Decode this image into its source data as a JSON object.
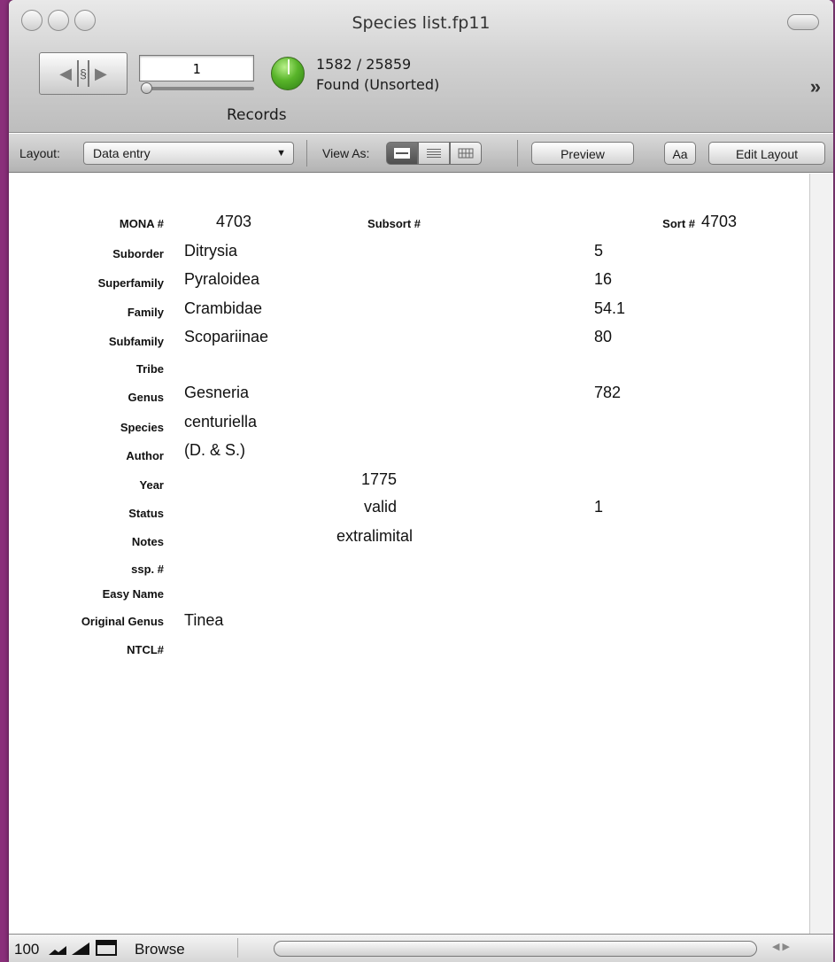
{
  "window": {
    "title": "Species list.fp11"
  },
  "status_toolbar": {
    "current_record": "1",
    "found_count": "1582 / 25859",
    "found_state": "Found (Unsorted)",
    "records_label": "Records",
    "more_chevron": "»"
  },
  "layout_bar": {
    "layout_label": "Layout:",
    "layout_selected": "Data entry",
    "view_as_label": "View As:",
    "preview_label": "Preview",
    "aa_label": "Aa",
    "edit_layout_label": "Edit Layout"
  },
  "record": {
    "mona_label": "MONA #",
    "mona_value": "4703",
    "subsort_label": "Subsort #",
    "sort_label": "Sort #",
    "sort_value": "4703",
    "rows": [
      {
        "label": "Suborder",
        "value": "Ditrysia",
        "num": "5"
      },
      {
        "label": "Superfamily",
        "value": "Pyraloidea",
        "num": "16"
      },
      {
        "label": "Family",
        "value": "Crambidae",
        "num": "54.1"
      },
      {
        "label": "Subfamily",
        "value": "Scopariinae",
        "num": "80"
      },
      {
        "label": "Tribe",
        "value": "",
        "num": ""
      },
      {
        "label": "Genus",
        "value": "Gesneria",
        "num": "782"
      },
      {
        "label": "Species",
        "value": "centuriella",
        "num": ""
      },
      {
        "label": "Author",
        "value": "(D. & S.)",
        "num": ""
      }
    ],
    "year_label": "Year",
    "year_value": "1775",
    "status_label": "Status",
    "status_value": "valid",
    "status_num": "1",
    "notes_label": "Notes",
    "notes_value": "extralimital",
    "ssp_label": "ssp. #",
    "easy_name_label": "Easy Name",
    "original_genus_label": "Original Genus",
    "original_genus_value": "Tinea",
    "ntcl_label": "NTCL#"
  },
  "bottom_bar": {
    "zoom": "100",
    "mode": "Browse"
  }
}
